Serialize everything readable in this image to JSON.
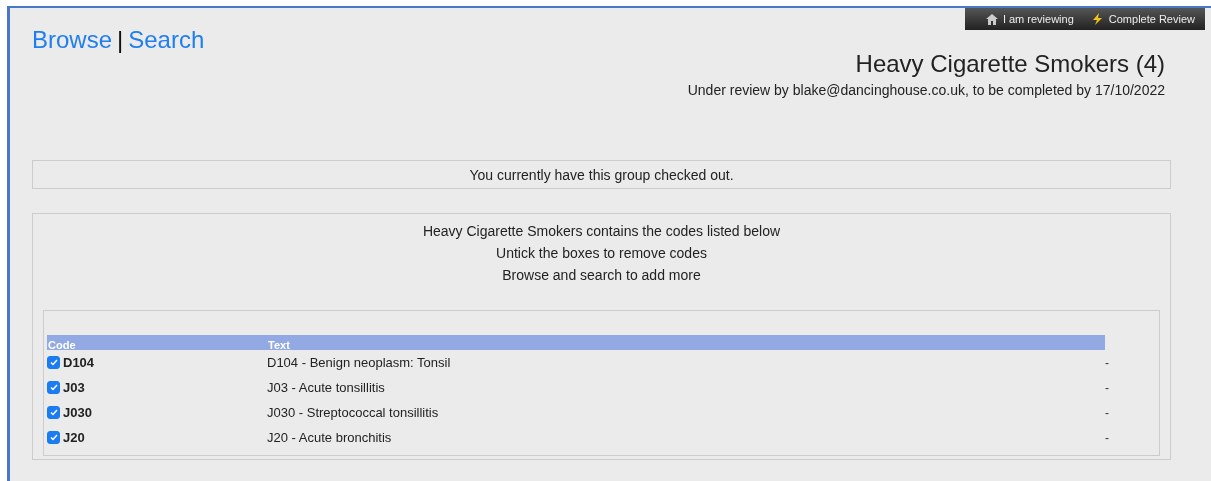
{
  "toolbar": {
    "items": [
      {
        "kind": "home",
        "label": "I am reviewing"
      },
      {
        "kind": "lightning",
        "label": "Complete Review"
      }
    ]
  },
  "nav": {
    "links": [
      "Browse",
      "Search"
    ],
    "separator": "|"
  },
  "header": {
    "title": "Heavy Cigarette Smokers (4)",
    "subtitle": "Under review by blake@dancinghouse.co.uk, to be completed by 17/10/2022"
  },
  "notice": "You currently have this group checked out.",
  "instructions": [
    "Heavy Cigarette Smokers contains the codes listed below",
    "Untick the boxes to remove codes",
    "Browse and search to add more"
  ],
  "table": {
    "columns": [
      "Code",
      "Text"
    ],
    "rows": [
      {
        "code": "D104",
        "text": "D104 - Benign neoplasm: Tonsil",
        "column_3": "-",
        "checked": true
      },
      {
        "code": "J03",
        "text": "J03 - Acute tonsillitis",
        "column_3": "-",
        "checked": true
      },
      {
        "code": "J030",
        "text": "J030 - Streptococcal tonsillitis",
        "column_3": "-",
        "checked": true
      },
      {
        "code": "J20",
        "text": "J20 - Acute bronchitis",
        "column_3": "-",
        "checked": true
      }
    ]
  }
}
